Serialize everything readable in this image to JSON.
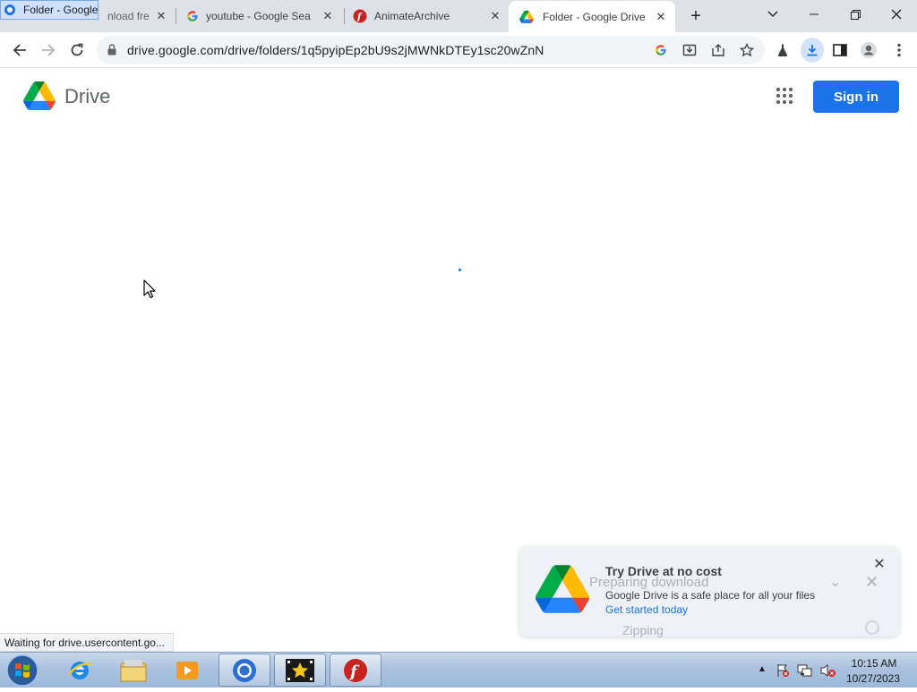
{
  "browser": {
    "tabs": [
      {
        "label": "nload fre",
        "favicon": "download-favicon"
      },
      {
        "label": "youtube - Google Sea",
        "favicon": "google-favicon"
      },
      {
        "label": "AnimateArchive",
        "favicon": "flash-favicon"
      },
      {
        "label": "Folder - Google Drive",
        "favicon": "drive-favicon",
        "active": true
      }
    ],
    "floating_tab_label": "Folder - Google",
    "url": "drive.google.com/drive/folders/1q5pyipEp2bU9s2jMWNkDTEy1sc20wZnN",
    "status_text": "Waiting for drive.usercontent.go..."
  },
  "drive": {
    "product_name": "Drive",
    "sign_in_label": "Sign in",
    "accent_color": "#1a73e8"
  },
  "toast": {
    "title": "Try Drive at no cost",
    "description": "Google Drive is a safe place for all your files",
    "link": "Get started today",
    "ghost_heading": "Preparing download",
    "ghost_status": "Zipping"
  },
  "taskbar": {
    "apps": [
      "internet-explorer-icon",
      "file-explorer-icon",
      "media-player-icon",
      "chrome-icon",
      "movie-maker-icon",
      "flash-icon"
    ],
    "time": "10:15 AM",
    "date": "10/27/2023"
  }
}
